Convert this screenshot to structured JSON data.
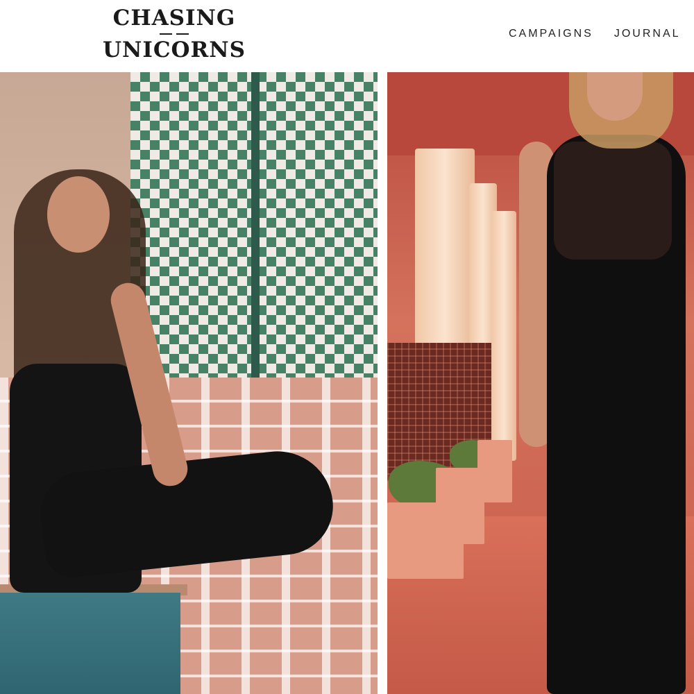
{
  "header": {
    "logo": {
      "line1": "CHASING",
      "line2": "UNICORNS"
    },
    "nav": [
      {
        "label": "CAMPAIGNS"
      },
      {
        "label": "JOURNAL"
      }
    ]
  },
  "colors": {
    "background": "#ffffff",
    "text": "#222222",
    "tile_green": "#2f7a5c",
    "terracotta": "#c75c4a"
  },
  "images": {
    "left": {
      "name": "model-seated-by-pool"
    },
    "right": {
      "name": "model-standing-in-arcade"
    }
  }
}
